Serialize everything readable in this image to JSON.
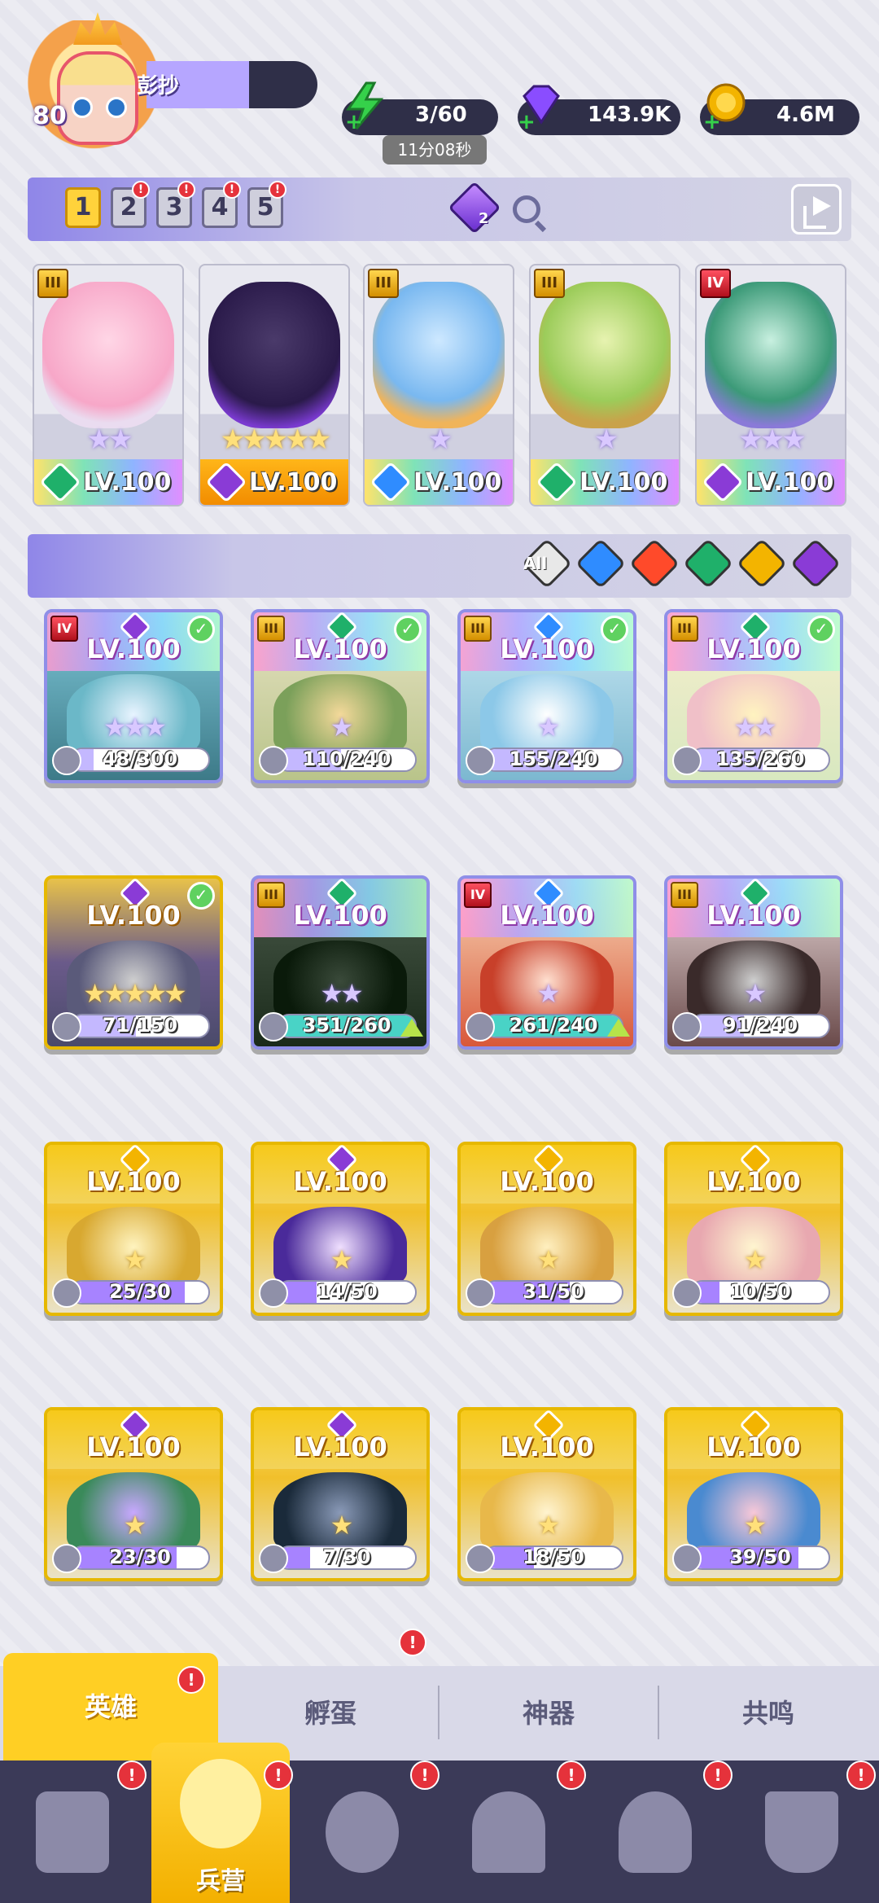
{
  "player": {
    "level": "80",
    "name": "彭抄"
  },
  "resources": {
    "energy": {
      "value": "3/60",
      "timer": "11分08秒",
      "icon": "lightning-icon",
      "color": "#35d14a"
    },
    "gems": {
      "value": "143.9K",
      "icon": "diamond-icon",
      "color": "#8a4dff"
    },
    "coins": {
      "value": "4.6M",
      "icon": "coin-icon",
      "color": "#f3b400"
    }
  },
  "team": {
    "slots": [
      "1",
      "2",
      "3",
      "4",
      "5"
    ],
    "active_slot": "1",
    "gem_count": "2",
    "members": [
      {
        "rank": "III",
        "level": "LV.100",
        "element": "leaf",
        "stars": "★★"
      },
      {
        "rank": "",
        "level": "LV.100",
        "element": "dark",
        "stars": "★★★★★"
      },
      {
        "rank": "III",
        "level": "LV.100",
        "element": "water",
        "stars": "★"
      },
      {
        "rank": "III",
        "level": "LV.100",
        "element": "leaf",
        "stars": "★"
      },
      {
        "rank": "IV",
        "level": "LV.100",
        "element": "dark",
        "stars": "★★★"
      }
    ]
  },
  "filters": {
    "all_label": "All",
    "elements": [
      "water",
      "fire",
      "leaf",
      "light",
      "dark"
    ]
  },
  "heroes": [
    {
      "rank": "IV",
      "level": "LV.100",
      "element": "dark",
      "checked": true,
      "stars": "★★★",
      "progress": "48/300"
    },
    {
      "rank": "III",
      "level": "LV.100",
      "element": "leaf",
      "checked": true,
      "stars": "★",
      "progress": "110/240"
    },
    {
      "rank": "III",
      "level": "LV.100",
      "element": "water",
      "checked": true,
      "stars": "★",
      "progress": "155/240"
    },
    {
      "rank": "III",
      "level": "LV.100",
      "element": "leaf",
      "checked": true,
      "stars": "★★",
      "progress": "135/260"
    },
    {
      "rank": "",
      "level": "LV.100",
      "element": "dark",
      "checked": true,
      "stars": "★★★★★",
      "progress": "71/150"
    },
    {
      "rank": "III",
      "level": "LV.100",
      "element": "leaf",
      "checked": false,
      "stars": "★★",
      "progress": "351/260"
    },
    {
      "rank": "IV",
      "level": "LV.100",
      "element": "water",
      "checked": false,
      "stars": "★",
      "progress": "261/240"
    },
    {
      "rank": "III",
      "level": "LV.100",
      "element": "leaf",
      "checked": false,
      "stars": "★",
      "progress": "91/240"
    },
    {
      "rank": "",
      "level": "LV.100",
      "element": "light",
      "checked": false,
      "stars": "★",
      "progress": "25/30"
    },
    {
      "rank": "",
      "level": "LV.100",
      "element": "dark",
      "checked": false,
      "stars": "★",
      "progress": "14/50"
    },
    {
      "rank": "",
      "level": "LV.100",
      "element": "light",
      "checked": false,
      "stars": "★",
      "progress": "31/50"
    },
    {
      "rank": "",
      "level": "LV.100",
      "element": "light",
      "checked": false,
      "stars": "★",
      "progress": "10/50"
    },
    {
      "rank": "",
      "level": "LV.100",
      "element": "dark",
      "checked": false,
      "stars": "★",
      "progress": "23/30"
    },
    {
      "rank": "",
      "level": "LV.100",
      "element": "dark",
      "checked": false,
      "stars": "★",
      "progress": "7/30"
    },
    {
      "rank": "",
      "level": "LV.100",
      "element": "light",
      "checked": false,
      "stars": "★",
      "progress": "18/50"
    },
    {
      "rank": "",
      "level": "LV.100",
      "element": "light",
      "checked": false,
      "stars": "★",
      "progress": "39/50"
    }
  ],
  "tabs": [
    {
      "label": "英雄",
      "active": true,
      "alert": true
    },
    {
      "label": "孵蛋",
      "active": false,
      "alert": true
    },
    {
      "label": "神器",
      "active": false,
      "alert": false
    },
    {
      "label": "共鸣",
      "active": false,
      "alert": false
    }
  ],
  "bottom_nav": [
    {
      "label": "",
      "icon": "cards-icon",
      "alert": true
    },
    {
      "label": "兵营",
      "icon": "barracks-icon",
      "alert": true,
      "active": true
    },
    {
      "label": "",
      "icon": "map-icon",
      "alert": true
    },
    {
      "label": "",
      "icon": "castle-icon",
      "alert": true
    },
    {
      "label": "",
      "icon": "mushroom-house-icon",
      "alert": true
    },
    {
      "label": "",
      "icon": "banner-icon",
      "alert": true
    }
  ],
  "alert_mark": "!",
  "element_colors": {
    "water": "#2f8cff",
    "fire": "#ff4a2a",
    "leaf": "#1fb06a",
    "light": "#f3b400",
    "dark": "#8a3bd6"
  }
}
